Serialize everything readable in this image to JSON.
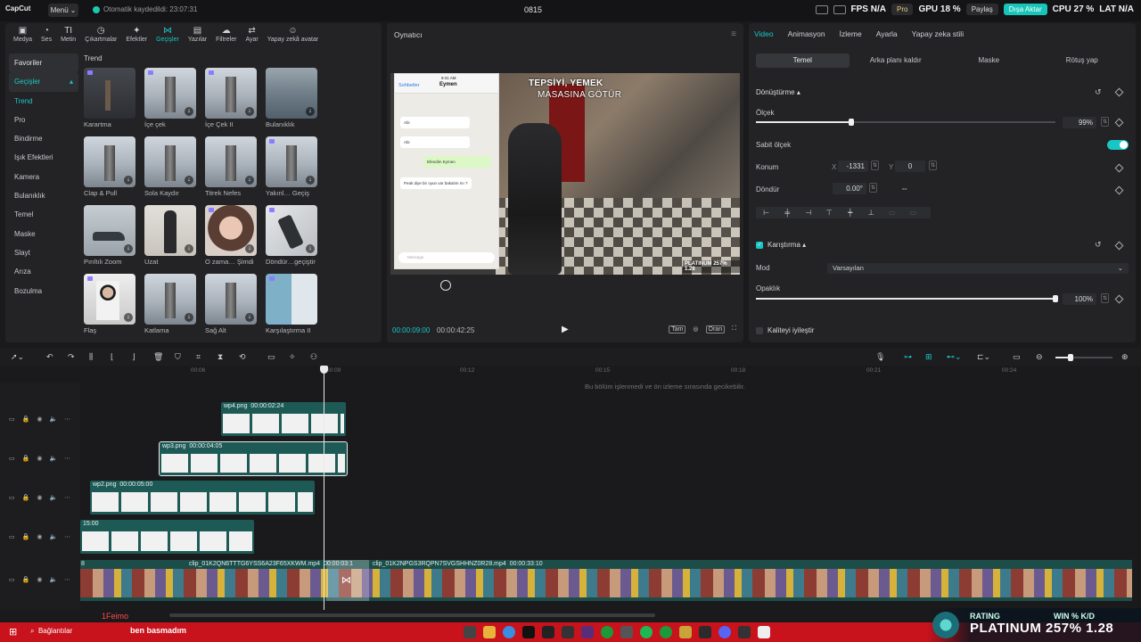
{
  "topbar": {
    "logo": "CapCut",
    "menu_label": "Menü",
    "autosave": "Otomatik kaydedildi: 23:07:31",
    "project_name": "0815",
    "pro_label": "Pro",
    "share_label": "Paylaş",
    "export_label": "Dışa Aktar",
    "hud_fps": "FPS N/A",
    "hud_gpu": "GPU 18 %",
    "hud_cpu": "CPU 27 %",
    "hud_lat": "LAT N/A"
  },
  "tool_tabs": [
    {
      "label": "Medya",
      "icon": "media-icon",
      "glyph": "▣"
    },
    {
      "label": "Ses",
      "icon": "audio-icon",
      "glyph": "◔"
    },
    {
      "label": "Metin",
      "icon": "text-icon",
      "glyph": "TI"
    },
    {
      "label": "Çıkartmalar",
      "icon": "sticker-icon",
      "glyph": "◷"
    },
    {
      "label": "Efektler",
      "icon": "effects-icon",
      "glyph": "✦"
    },
    {
      "label": "Geçişler",
      "icon": "transitions-icon",
      "glyph": "⋈"
    },
    {
      "label": "Yazılar",
      "icon": "captions-icon",
      "glyph": "▤"
    },
    {
      "label": "Filtreler",
      "icon": "filters-icon",
      "glyph": "☁"
    },
    {
      "label": "Ayar",
      "icon": "adjust-icon",
      "glyph": "⇄"
    },
    {
      "label": "Yapay zekâ avatar",
      "icon": "ai-avatar-icon",
      "glyph": "☺"
    }
  ],
  "categories": [
    "Favoriler",
    "Geçişler",
    "Trend",
    "Pro",
    "Bindirme",
    "Işık Efektleri",
    "Kamera",
    "Bulanıklık",
    "Temel",
    "Maske",
    "Slayt",
    "Arıza",
    "Bozulma"
  ],
  "section_title": "Trend",
  "transitions": [
    {
      "label": "Karartma",
      "thumb": "t-dark",
      "pro": true,
      "dl": false
    },
    {
      "label": "İçe çek",
      "thumb": "t-city t-tower",
      "pro": true,
      "dl": true
    },
    {
      "label": "İçe Çek II",
      "thumb": "t-city t-tower",
      "pro": true,
      "dl": true
    },
    {
      "label": "Bulanıklık",
      "thumb": "t-boat",
      "pro": false,
      "dl": true
    },
    {
      "label": "Clap & Pull",
      "thumb": "t-city t-tower",
      "pro": false,
      "dl": true
    },
    {
      "label": "Sola Kaydır",
      "thumb": "t-city t-tower",
      "pro": false,
      "dl": true
    },
    {
      "label": "Titrek Nefes",
      "thumb": "t-city t-tower",
      "pro": false,
      "dl": true
    },
    {
      "label": "Yakınl… Geçiş",
      "thumb": "t-city t-tower",
      "pro": true,
      "dl": true
    },
    {
      "label": "Pırıltılı Zoom",
      "thumb": "t-car",
      "pro": false,
      "dl": true
    },
    {
      "label": "Uzat",
      "thumb": "t-dress",
      "pro": false,
      "dl": true
    },
    {
      "label": "O zama… Şimdi",
      "thumb": "t-face",
      "pro": true,
      "dl": true
    },
    {
      "label": "Döndür…geçiştir",
      "thumb": "t-bottle",
      "pro": true,
      "dl": true
    },
    {
      "label": "Flaş",
      "thumb": "t-glasses",
      "pro": true,
      "dl": true
    },
    {
      "label": "Katlama",
      "thumb": "t-city t-tower",
      "pro": false,
      "dl": true
    },
    {
      "label": "Sağ Alt",
      "thumb": "t-city t-tower",
      "pro": false,
      "dl": true
    },
    {
      "label": "Karşılaştırma II",
      "thumb": "t-mount",
      "pro": true,
      "dl": false
    }
  ],
  "player": {
    "title": "Oynatıcı",
    "caption_line1": "TEPSİYİ, YEMEK",
    "caption_line2": "MASASINA GÖTÜR",
    "rank_mini": "PLATINUM 257% 1.28",
    "phone_back": "Sohbetler",
    "phone_name": "Eymen",
    "phone_time": "9:41 AM",
    "bubbles": [
      "Abi",
      "Abi",
      "Efendim Eymen",
      "Peak diye bir oyun var bakalım mı ?"
    ],
    "phone_input": "Message",
    "time_current": "00:00:09:00",
    "time_duration": "00:00:42:25",
    "ctrl_full": "Tam",
    "ctrl_ratio": "Oran"
  },
  "right_panel": {
    "tabs": [
      "Video",
      "Animasyon",
      "İzleme",
      "Ayarla",
      "Yapay zeka stili"
    ],
    "subtabs": [
      "Temel",
      "Arka planı kaldır",
      "Maske",
      "Rötuş yap"
    ],
    "transform_title": "Dönüştürme",
    "scale_label": "Ölçek",
    "scale_value": "99%",
    "scale_fraction": 0.99,
    "uniform_scale_label": "Sabit ölçek",
    "position_label": "Konum",
    "x_label": "X",
    "x_value": "-1331",
    "y_label": "Y",
    "y_value": "0",
    "rotate_label": "Döndür",
    "rotate_value": "0.00°",
    "blend_title": "Karıştırma",
    "mode_label": "Mod",
    "mode_value": "Varsayılan",
    "opacity_label": "Opaklık",
    "opacity_value": "100%",
    "opacity_fraction": 1.0,
    "enhance_label": "Kaliteyi iyileştir"
  },
  "timeline": {
    "ticks": [
      "00:06",
      "00:12",
      "00:15",
      "00:18",
      "00:21",
      "00:24"
    ],
    "tick_first": "00:09",
    "note": "Bu bölüm işlenmedi ve ön izleme sırasında gecikebilir.",
    "clips": [
      {
        "name": "wp4.png",
        "dur": "00:00:02:24"
      },
      {
        "name": "wp3.png",
        "dur": "00:00:04:05"
      },
      {
        "name": "wp2.png",
        "dur": "00:00:05:00"
      },
      {
        "name": "",
        "dur": "15:00"
      }
    ],
    "main_clip_a": "clip_01K2QN6TTTG6YSS6A23F65XKWM.mp4",
    "main_clip_a_dur": "00:00:03:1",
    "main_clip_b": "clip_01K2NPGS3RQPN7SVGSHHNZ0R28.mp4",
    "main_clip_b_dur": "00:00:33:10",
    "main_lead": "8"
  },
  "overlay": {
    "chat_name": "1Feimo",
    "chat_msg": "ben basmadım",
    "rank_label": "RATING",
    "rank_value": "PLATINUM 257% 1.28",
    "winkd_label": "WIN % K/D"
  },
  "taskbar": {
    "search_label": "Bağlantılar"
  },
  "colors": {
    "accent": "#19c6c6",
    "taskbar": "#c8121c",
    "clip": "#1e5a55"
  }
}
